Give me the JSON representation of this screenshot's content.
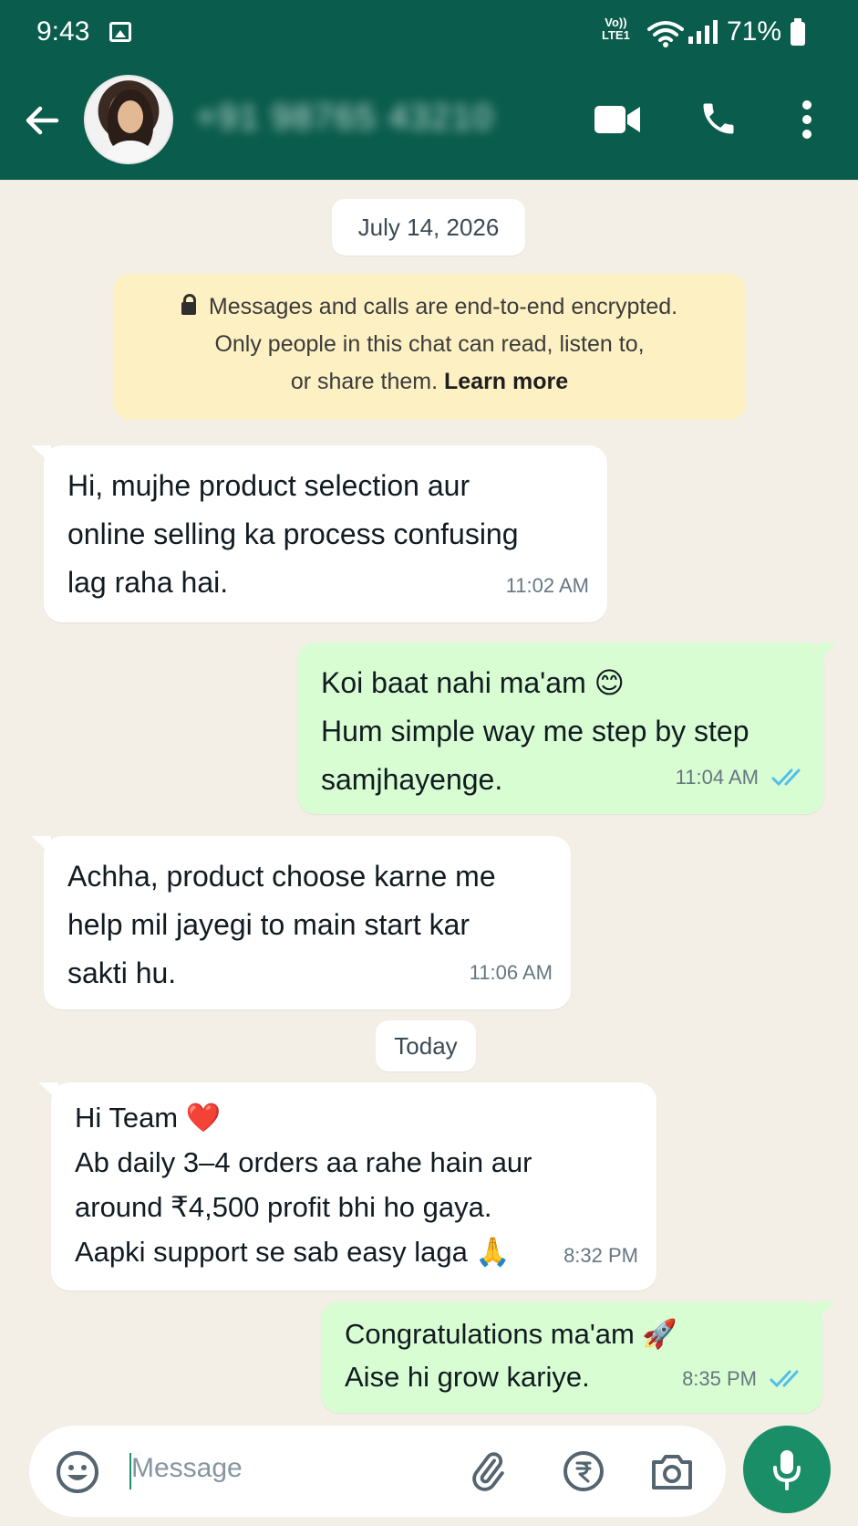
{
  "status_bar": {
    "time": "9:43",
    "volte_top": "Vo))",
    "volte_bottom": "LTE1",
    "battery": "71%"
  },
  "header": {
    "contact": "+91 98765 43210",
    "icons": [
      "back-arrow-icon",
      "video-call-icon",
      "phone-icon",
      "more-vertical-icon"
    ]
  },
  "chat": {
    "date_first": "July 14, 2026",
    "encryption": {
      "line1": "Messages and calls are end-to-end encrypted.",
      "line2": "Only people in this chat can read, listen to,",
      "line3_prefix": "or share them. ",
      "learn_more": "Learn more"
    },
    "messages": [
      {
        "dir": "in",
        "lines": [
          "Hi, mujhe product selection aur",
          "online selling ka process confusing",
          "lag raha hai."
        ],
        "time": "11:02 AM"
      },
      {
        "dir": "out",
        "lines": [
          "Koi baat nahi ma'am 😊",
          "Hum simple way me step by step",
          "samjhayenge."
        ],
        "time": "11:04 AM",
        "read": true
      },
      {
        "dir": "in",
        "lines": [
          "Achha, product choose karne me",
          "help mil jayegi to main start kar",
          "sakti hu."
        ],
        "time": "11:06 AM"
      }
    ],
    "date_second": "Today",
    "messages_today": [
      {
        "dir": "in",
        "lines": [
          "Hi Team ❤️",
          "Ab daily 3–4 orders aa rahe hain aur",
          "around ₹4,500 profit bhi ho gaya.",
          "Aapki support se sab easy laga 🙏"
        ],
        "time": "8:32 PM"
      },
      {
        "dir": "out",
        "lines": [
          "Congratulations ma'am 🚀",
          "Aise hi grow kariye."
        ],
        "time": "8:35 PM",
        "read": true
      }
    ]
  },
  "input": {
    "placeholder": "Message"
  },
  "colors": {
    "header": "#0a5c4c",
    "background": "#f3eee6",
    "outgoing": "#d8fdd2",
    "incoming": "#ffffff",
    "read_ticks": "#53bdeb",
    "mic_button": "#1a8f67"
  }
}
